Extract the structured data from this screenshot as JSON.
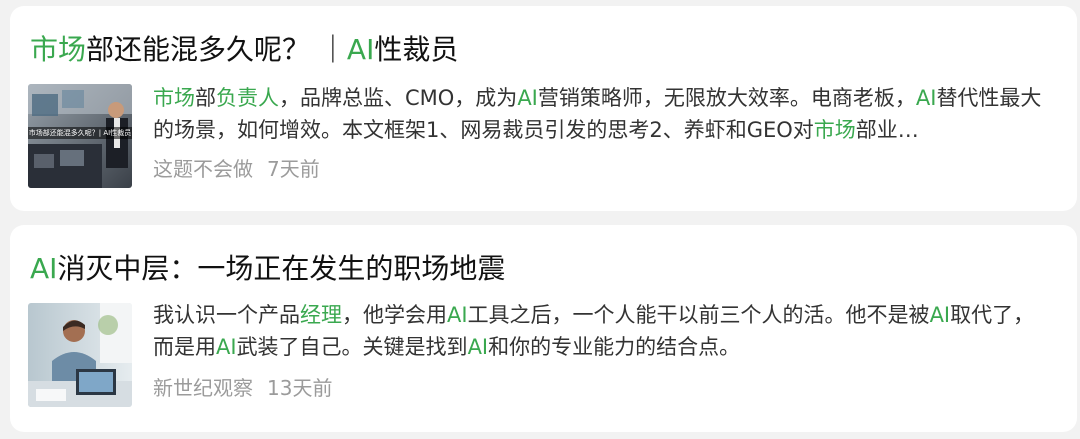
{
  "results": [
    {
      "title": [
        {
          "text": "市场",
          "highlight": true
        },
        {
          "text": "部还能混多久呢？ ｜",
          "highlight": false
        },
        {
          "text": "AI",
          "highlight": true
        },
        {
          "text": "性裁员",
          "highlight": false
        }
      ],
      "thumbnail_caption": "市场部还能混多久呢？| AI性裁员",
      "snippet": [
        {
          "text": "市场",
          "highlight": true
        },
        {
          "text": "部",
          "highlight": false
        },
        {
          "text": "负责人",
          "highlight": true
        },
        {
          "text": "，品牌总监、CMO，成为",
          "highlight": false
        },
        {
          "text": "AI",
          "highlight": true
        },
        {
          "text": "营销策略师，无限放大效率。电商老板，",
          "highlight": false
        },
        {
          "text": "AI",
          "highlight": true
        },
        {
          "text": "替代性最大的场景，如何增效。本文框架1、网易裁员引发的思考2、养虾和GEO对",
          "highlight": false
        },
        {
          "text": "市场",
          "highlight": true
        },
        {
          "text": "部业…",
          "highlight": false
        }
      ],
      "source": "这题不会做",
      "time": "7天前"
    },
    {
      "title": [
        {
          "text": "AI",
          "highlight": true
        },
        {
          "text": "消灭中层：一场正在发生的职场地震",
          "highlight": false
        }
      ],
      "snippet": [
        {
          "text": "我认识一个产品",
          "highlight": false
        },
        {
          "text": "经理",
          "highlight": true
        },
        {
          "text": "，他学会用",
          "highlight": false
        },
        {
          "text": "AI",
          "highlight": true
        },
        {
          "text": "工具之后，一个人能干以前三个人的活。他不是被",
          "highlight": false
        },
        {
          "text": "AI",
          "highlight": true
        },
        {
          "text": "取代了，而是用",
          "highlight": false
        },
        {
          "text": "AI",
          "highlight": true
        },
        {
          "text": "武装了自己。关键是找到",
          "highlight": false
        },
        {
          "text": "AI",
          "highlight": true
        },
        {
          "text": "和你的专业能力的结合点。",
          "highlight": false
        }
      ],
      "source": "新世纪观察",
      "time": "13天前"
    }
  ]
}
